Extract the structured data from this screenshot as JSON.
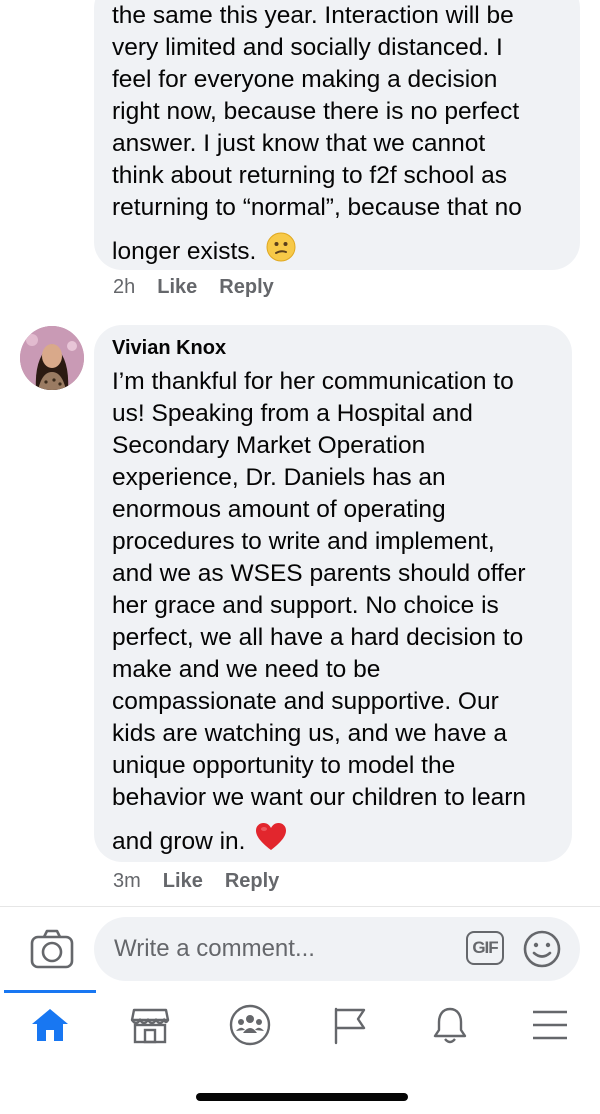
{
  "comments": [
    {
      "author": "",
      "lines": [
        "the same this year.  Interaction will be",
        "very limited and socially distanced.  I",
        "feel for everyone making a decision",
        "right now, because there is no perfect",
        "answer.  I just know that we cannot",
        "think about returning to f2f school as",
        "returning to “normal”, because that no",
        "longer exists."
      ],
      "emoji": "confused-face-emoji",
      "time": "2h",
      "like_label": "Like",
      "reply_label": "Reply"
    },
    {
      "author": "Vivian Knox",
      "lines": [
        "I’m thankful for her communication to",
        "us! Speaking from a Hospital and",
        "Secondary Market Operation",
        "experience, Dr. Daniels has an",
        "enormous amount of operating",
        "procedures to write and implement,",
        "and we as WSES parents should offer",
        "her grace and support. No choice is",
        "perfect, we all have a hard decision to",
        "make and we need to be",
        "compassionate and supportive. Our",
        "kids are watching us, and we have a",
        "unique opportunity to model the",
        "behavior we want our children to learn",
        "and grow in."
      ],
      "emoji": "red-heart-emoji",
      "time": "3m",
      "like_label": "Like",
      "reply_label": "Reply"
    }
  ],
  "composer": {
    "placeholder": "Write a comment...",
    "gif_label": "GIF"
  },
  "tabbar": {
    "items": [
      "home",
      "marketplace",
      "groups",
      "pages",
      "notifications",
      "menu"
    ],
    "active": "home",
    "active_color": "#1877f2"
  },
  "colors": {
    "bubble": "#f0f2f5",
    "meta_text": "#65676b",
    "accent": "#1877f2"
  }
}
